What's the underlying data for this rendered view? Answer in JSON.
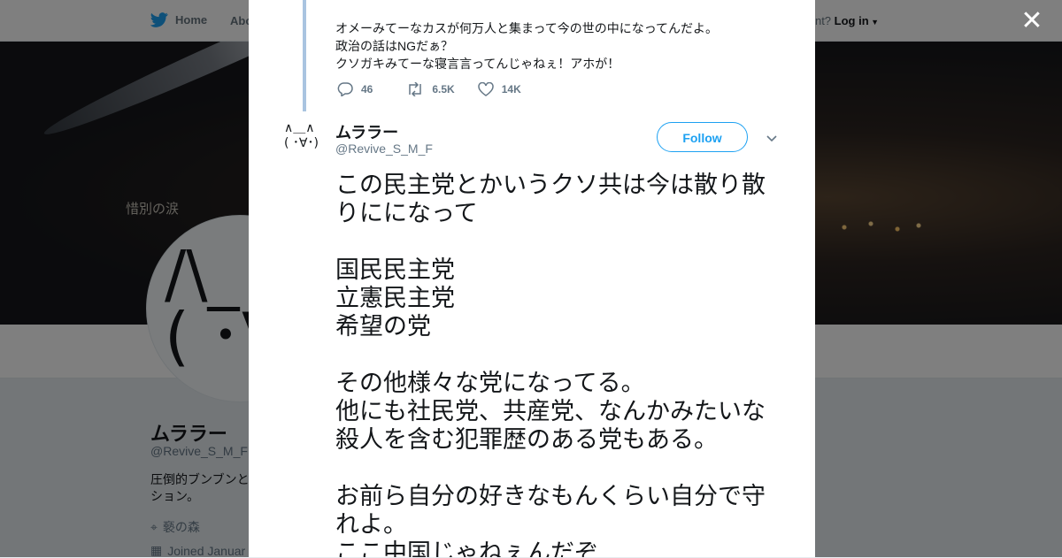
{
  "nav": {
    "home_label": "Home",
    "about_label": "Abo",
    "account_prompt": "count?",
    "login_label": "Log in"
  },
  "banner": {
    "caption": "惜別の涙"
  },
  "profile": {
    "name": "ムララー",
    "handle": "@Revive_S_M_F",
    "bio_line1": "圧倒的ブンブンと",
    "bio_line2": "ション。",
    "location": "褻の森",
    "joined": "Joined Januar",
    "avatar_face_top": "/\\_",
    "avatar_face_bottom": "( ･∀"
  },
  "modal": {
    "close_icon": "close-icon",
    "parent_tweet": {
      "lines": [
        "オメーみてーなカスが何万人と集まって今の世の中になってんだよ。",
        "政治の話はNGだぁ？",
        "クソガキみてーな寝言言ってんじゃねぇ！アホが！"
      ],
      "replies": "46",
      "retweets": "6.5K",
      "likes": "14K"
    },
    "tweet": {
      "author_name": "ムララー",
      "author_handle": "@Revive_S_M_F",
      "avatar_line1": "∧＿∧",
      "avatar_line2": "( ･∀･)",
      "follow_label": "Follow",
      "body": [
        "この民主党とかいうクソ共は今は散り散",
        "りにになって",
        "",
        "国民民主党",
        "立憲民主党",
        "希望の党",
        "",
        "その他様々な党になってる。",
        "他にも社民党、共産党、なんかみたいな",
        "殺人を含む犯罪歴のある党もある。",
        "",
        "お前ら自分の好きなもんくらい自分で守",
        "れよ。",
        "ここ中国じゃねぇんだぞ"
      ]
    }
  },
  "colors": {
    "twitter_blue": "#1da1f2",
    "thread_line": "#a9c4e0",
    "text_primary": "#14171a",
    "text_secondary": "#657786"
  }
}
